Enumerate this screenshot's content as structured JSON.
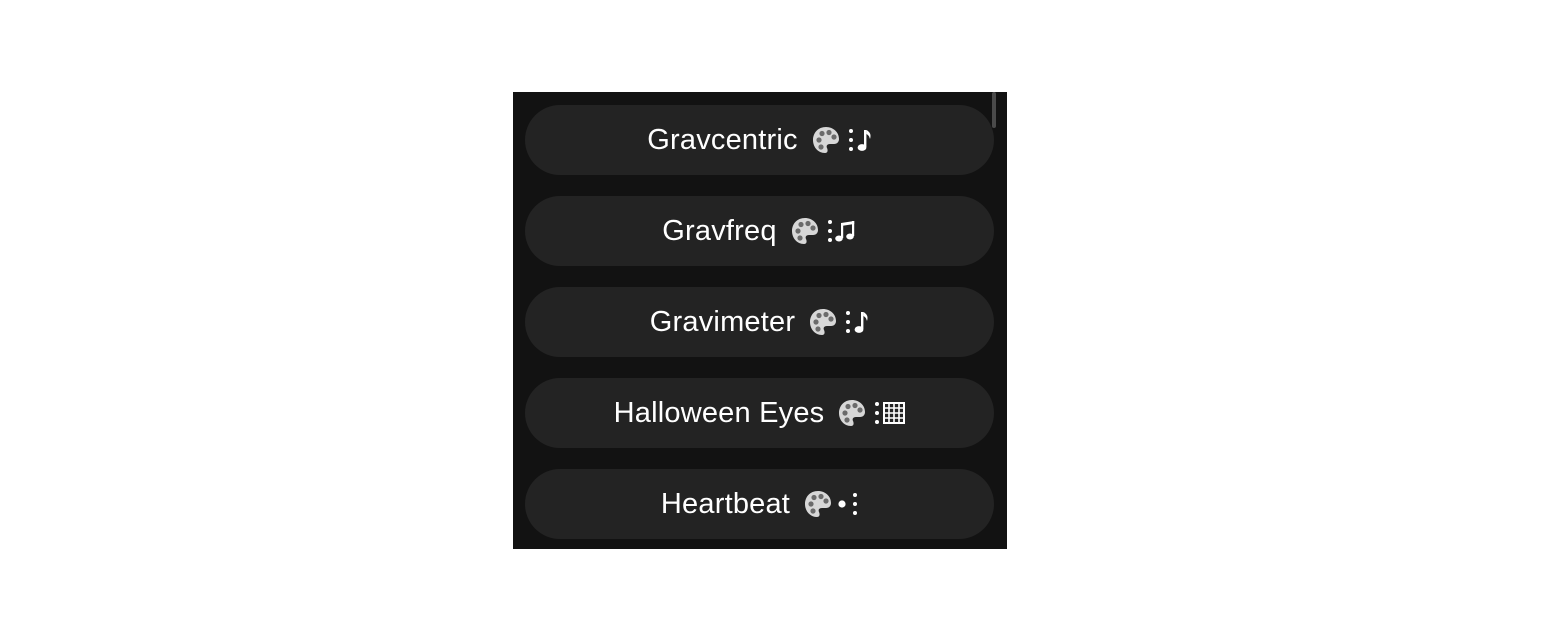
{
  "effects": [
    {
      "name": "Gravcentric",
      "icons": [
        "palette-icon",
        "dots-icon",
        "music-note-icon"
      ]
    },
    {
      "name": "Gravfreq",
      "icons": [
        "palette-icon",
        "dots-icon",
        "music-notes-icon"
      ]
    },
    {
      "name": "Gravimeter",
      "icons": [
        "palette-icon",
        "dots-icon",
        "music-note-icon"
      ]
    },
    {
      "name": "Halloween Eyes",
      "icons": [
        "palette-icon",
        "dots-icon",
        "grid-icon"
      ]
    },
    {
      "name": "Heartbeat",
      "icons": [
        "palette-icon",
        "dot-icon",
        "dots-icon"
      ]
    }
  ],
  "colors": {
    "panel_bg": "#121212",
    "item_bg": "#232323",
    "text": "#ffffff"
  }
}
